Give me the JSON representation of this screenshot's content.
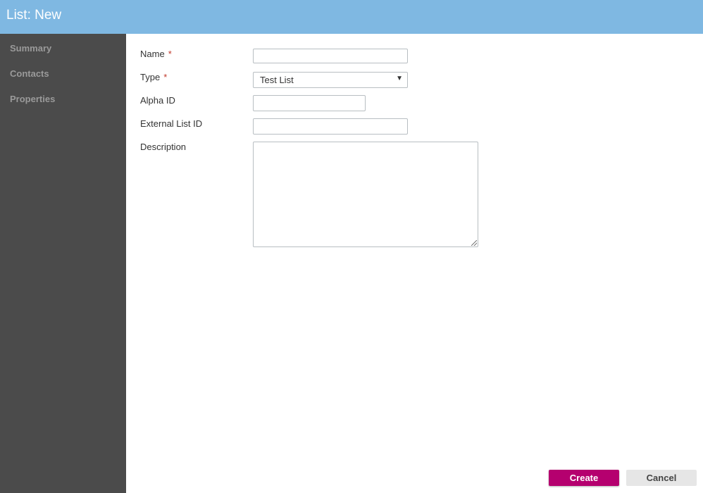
{
  "header": {
    "title": "List: New"
  },
  "sidebar": {
    "items": [
      {
        "label": "Summary"
      },
      {
        "label": "Contacts"
      },
      {
        "label": "Properties"
      }
    ]
  },
  "form": {
    "required_marker": "*",
    "name": {
      "label": "Name",
      "value": ""
    },
    "type": {
      "label": "Type",
      "value": "Test List"
    },
    "alpha_id": {
      "label": "Alpha ID",
      "value": ""
    },
    "external_list_id": {
      "label": "External List ID",
      "value": ""
    },
    "description": {
      "label": "Description",
      "value": ""
    }
  },
  "buttons": {
    "create": "Create",
    "cancel": "Cancel"
  },
  "colors": {
    "header": "#7fb8e2",
    "sidebar": "#4b4b4b",
    "primary": "#b5006f"
  }
}
